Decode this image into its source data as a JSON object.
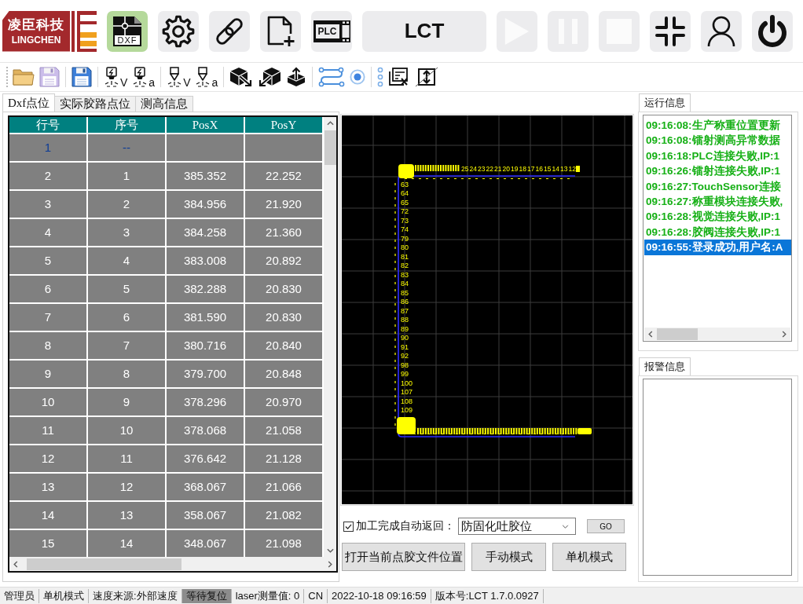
{
  "logo": {
    "name_cn": "凌臣科技",
    "name_en": "LINGCHEN"
  },
  "top_buttons": [
    {
      "kind": "dxf",
      "label": "DXF",
      "selected": true,
      "disabled": false
    },
    {
      "kind": "settings",
      "selected": false,
      "disabled": false
    },
    {
      "kind": "link",
      "selected": false,
      "disabled": false
    },
    {
      "kind": "new-file",
      "selected": false,
      "disabled": false
    },
    {
      "kind": "plc",
      "label": "PLC",
      "selected": false,
      "disabled": false
    },
    {
      "kind": "text",
      "label": "LCT",
      "selected": false,
      "disabled": false
    },
    {
      "kind": "play",
      "selected": false,
      "disabled": true
    },
    {
      "kind": "pause",
      "selected": false,
      "disabled": true
    },
    {
      "kind": "stop",
      "selected": false,
      "disabled": true
    },
    {
      "kind": "compress",
      "selected": false,
      "disabled": false
    },
    {
      "kind": "user",
      "selected": false,
      "disabled": false
    },
    {
      "kind": "power",
      "selected": false,
      "disabled": false
    }
  ],
  "toolbar": [
    [
      {
        "kind": "open-folder",
        "disabled": false
      },
      {
        "kind": "save",
        "disabled": true
      }
    ],
    [
      {
        "kind": "save",
        "disabled": false
      }
    ],
    [
      {
        "kind": "laser",
        "sub": "V",
        "disabled": false
      },
      {
        "kind": "laser",
        "sub": "a",
        "disabled": false
      }
    ],
    [
      {
        "kind": "nozzle",
        "sub": "V",
        "disabled": false
      },
      {
        "kind": "nozzle",
        "sub": "a",
        "disabled": false
      }
    ],
    [
      {
        "kind": "cube-out",
        "disabled": false
      },
      {
        "kind": "cube-in",
        "disabled": false
      },
      {
        "kind": "cube-up",
        "disabled": false
      }
    ],
    [
      {
        "kind": "path",
        "disabled": false
      },
      {
        "kind": "target",
        "disabled": false
      }
    ],
    [
      {
        "kind": "dots",
        "disabled": false
      },
      {
        "kind": "clear-list",
        "disabled": false
      },
      {
        "kind": "swap",
        "disabled": false
      }
    ]
  ],
  "left_tabs": [
    {
      "label": "Dxf点位",
      "selected": true
    },
    {
      "label": "实际胶路点位",
      "selected": false
    },
    {
      "label": "测高信息",
      "selected": false
    }
  ],
  "table": {
    "columns": [
      "行号",
      "序号",
      "PosX",
      "PosY"
    ],
    "rows": [
      {
        "selected": true,
        "cells": [
          "1",
          "--"
        ]
      },
      {
        "selected": false,
        "cells": [
          "2",
          "1",
          "385.352",
          "22.252"
        ]
      },
      {
        "selected": false,
        "cells": [
          "3",
          "2",
          "384.956",
          "21.920"
        ]
      },
      {
        "selected": false,
        "cells": [
          "4",
          "3",
          "384.258",
          "21.360"
        ]
      },
      {
        "selected": false,
        "cells": [
          "5",
          "4",
          "383.008",
          "20.892"
        ]
      },
      {
        "selected": false,
        "cells": [
          "6",
          "5",
          "382.288",
          "20.830"
        ]
      },
      {
        "selected": false,
        "cells": [
          "7",
          "6",
          "381.590",
          "20.830"
        ]
      },
      {
        "selected": false,
        "cells": [
          "8",
          "7",
          "380.716",
          "20.840"
        ]
      },
      {
        "selected": false,
        "cells": [
          "9",
          "8",
          "379.700",
          "20.848"
        ]
      },
      {
        "selected": false,
        "cells": [
          "10",
          "9",
          "378.296",
          "20.970"
        ]
      },
      {
        "selected": false,
        "cells": [
          "11",
          "10",
          "378.068",
          "21.058"
        ]
      },
      {
        "selected": false,
        "cells": [
          "12",
          "11",
          "376.642",
          "21.128"
        ]
      },
      {
        "selected": false,
        "cells": [
          "13",
          "12",
          "368.067",
          "21.066"
        ]
      },
      {
        "selected": false,
        "cells": [
          "14",
          "13",
          "358.067",
          "21.082"
        ]
      },
      {
        "selected": false,
        "cells": [
          "15",
          "14",
          "348.067",
          "21.098"
        ]
      }
    ]
  },
  "canvas": {
    "top_labels": [
      "25",
      "24",
      "23",
      "22",
      "21",
      "20",
      "19",
      "18",
      "17",
      "16",
      "15",
      "14",
      "13",
      "12"
    ],
    "left_labels": [
      "63",
      "64",
      "65",
      "72",
      "73",
      "74",
      "79",
      "80",
      "81",
      "82",
      "83",
      "84",
      "85",
      "86",
      "87",
      "88",
      "89",
      "90",
      "91",
      "92",
      "98",
      "99",
      "100",
      "107",
      "108",
      "109"
    ]
  },
  "auto_return": {
    "checked": true,
    "label": "加工完成自动返回：",
    "value": "防固化吐胶位"
  },
  "go_button": "GO",
  "action_buttons": [
    "打开当前点胶文件位置",
    "手动模式",
    "单机模式"
  ],
  "run_log": {
    "tab": {
      "label": "运行信息",
      "selected": true
    },
    "entries": [
      {
        "text": "09:16:08:生产称重位置更新",
        "selected": false
      },
      {
        "text": "09:16:08:镭射测高异常数据",
        "selected": false
      },
      {
        "text": "09:16:18:PLC连接失败,IP:1",
        "selected": false
      },
      {
        "text": "09:16:26:镭射连接失败,IP:1",
        "selected": false
      },
      {
        "text": "09:16:27:TouchSensor连接",
        "selected": false
      },
      {
        "text": "09:16:27:称重模块连接失败,",
        "selected": false
      },
      {
        "text": "09:16:28:视觉连接失败,IP:1",
        "selected": false
      },
      {
        "text": "09:16:28:胶阀连接失败,IP:1",
        "selected": false
      },
      {
        "text": "09:16:55:登录成功,用户名:A",
        "selected": true
      }
    ]
  },
  "alarm_log": {
    "tab": {
      "label": "报警信息",
      "selected": true
    }
  },
  "status_bar": [
    {
      "text": "管理员",
      "highlighted": false
    },
    {
      "text": "单机模式",
      "highlighted": false
    },
    {
      "text": "速度来源:外部速度",
      "highlighted": false
    },
    {
      "text": "等待复位",
      "highlighted": true
    },
    {
      "text": "laser测量值: 0",
      "highlighted": false
    },
    {
      "text": "CN",
      "highlighted": false
    },
    {
      "text": "2022-10-18 09:16:59",
      "highlighted": false
    },
    {
      "text": "版本号:LCT 1.7.0.0927",
      "highlighted": false
    }
  ]
}
